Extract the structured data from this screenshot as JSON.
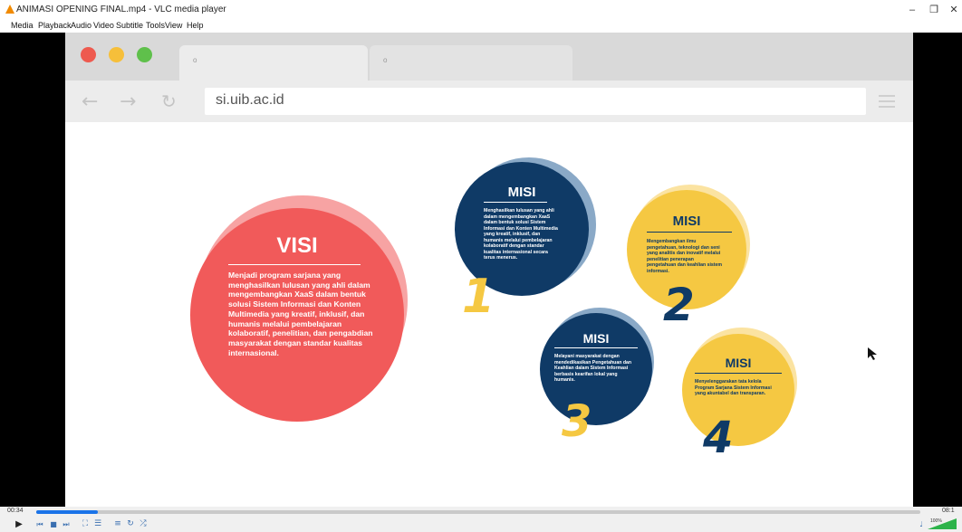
{
  "window": {
    "title": "ANIMASI OPENING FINAL.mp4 - VLC media player",
    "minimize": "–",
    "maximize": "❐",
    "close": "✕"
  },
  "menu": [
    "Media",
    "Playback",
    "Audio",
    "Video",
    "Subtitle",
    "Tools",
    "View",
    "Help"
  ],
  "browser": {
    "url": "si.uib.ac.id",
    "tab1_dot": "o",
    "tab2_dot": "o"
  },
  "visi": {
    "title": "VISI",
    "text": "Menjadi program sarjana yang menghasilkan lulusan yang ahli dalam mengembangkan XaaS dalam bentuk solusi Sistem Informasi dan Konten Multimedia yang kreatif, inklusif, dan humanis melalui pembelajaran kolaboratif, penelitian, dan pengabdian masyarakat dengan standar kualitas internasional."
  },
  "misi": [
    {
      "title": "MISI",
      "number": "1",
      "text": "Menghasilkan lulusan yang ahli dalam mengembangkan XaaS dalam bentuk solusi Sistem Informasi dan Konten Multimedia yang kreatif, inklusif, dan humanis melalui pembelajaran kolaboratif dengan standar kualitas internasional secara terus menerus."
    },
    {
      "title": "MISI",
      "number": "2",
      "text": "Mengembangkan ilmu pengetahuan, teknologi dan seni yang analitis dan inovatif melalui penelitian penerapan pengetahuan dan keahlian sistem informasi."
    },
    {
      "title": "MISI",
      "number": "3",
      "text": "Melayani masyarakat dengan mendedikasikan Pengetahuan dan Keahlian dalam Sistem Informasi berbasis kearifan lokal yang humanis."
    },
    {
      "title": "MISI",
      "number": "4",
      "text": "Menyelenggarakan tata kelola Program Sarjana Sistem Informasi yang akuntabel dan transparan."
    }
  ],
  "player": {
    "elapsed": "00:34",
    "total": "08:1",
    "progress": 0.07,
    "volume_label": "100%"
  },
  "colors": {
    "red": "#f15a5a",
    "navy": "#0f3a66",
    "yellow": "#f5c842"
  }
}
